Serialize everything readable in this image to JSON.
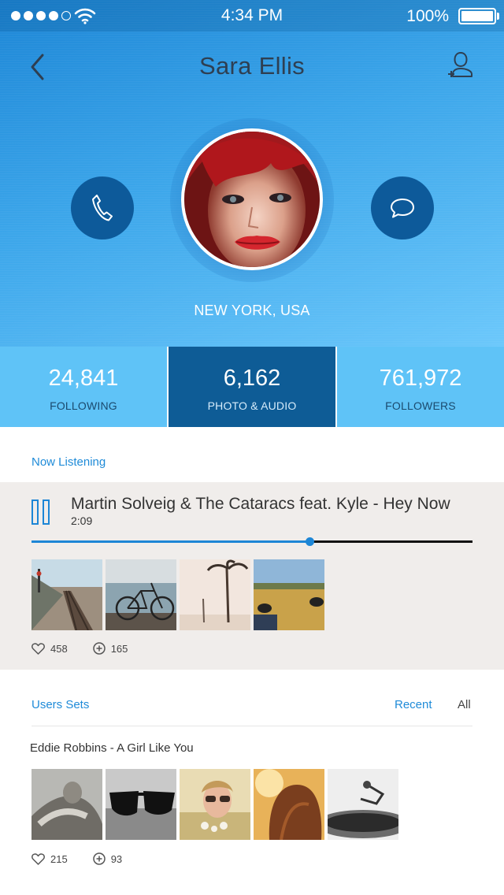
{
  "status_bar": {
    "signal_dots_filled": 4,
    "signal_dots_total": 5,
    "time": "4:34 PM",
    "battery": "100%",
    "battery_level": 1.0
  },
  "header": {
    "title": "Sara Ellis",
    "back_icon": "chevron-left-icon",
    "add_user_icon": "add-user-icon",
    "call_icon": "phone-icon",
    "message_icon": "chat-bubble-icon",
    "location": "NEW YORK, USA"
  },
  "stats": [
    {
      "value": "24,841",
      "label": "FOLLOWING",
      "active": false
    },
    {
      "value": "6,162",
      "label": "PHOTO & AUDIO",
      "active": true
    },
    {
      "value": "761,972",
      "label": "FOLLOWERS",
      "active": false
    }
  ],
  "now_listening": {
    "label": "Now Listening",
    "track": "Martin Solveig & The Cataracs feat. Kyle - Hey Now",
    "time": "2:09",
    "progress_fraction": 0.63,
    "likes": "458",
    "adds": "165"
  },
  "users_sets": {
    "label": "Users Sets",
    "filters": {
      "recent": "Recent",
      "all": "All"
    },
    "set_title": "Eddie Robbins - A Girl Like You",
    "likes": "215",
    "adds": "93"
  },
  "colors": {
    "accent": "#1d86d6",
    "stat_bg": "#5fc3f7",
    "stat_active_bg": "#0e5c96",
    "button_dark": "#0d5a9a",
    "player_bg": "#f0edeb"
  }
}
